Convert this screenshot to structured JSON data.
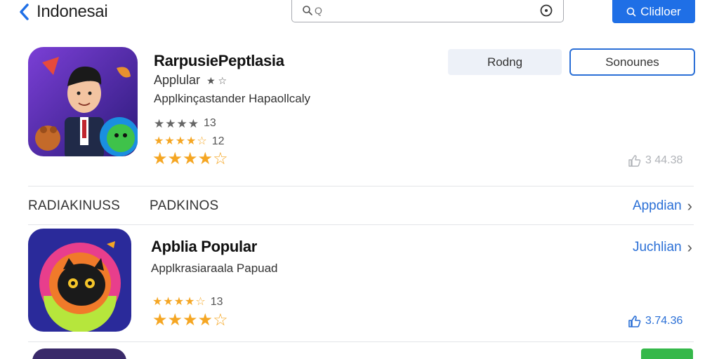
{
  "header": {
    "back_label": "Indonesai",
    "search_placeholder": "Q",
    "action_button": "Clidloer",
    "action_icon": "search-icon"
  },
  "featured": {
    "name": "RarpusiePeptlasia",
    "subtitle": "Applular",
    "subtitle_stars": "★ ☆",
    "description": "Applkinçastander Hapaollcaly",
    "rating_rows": [
      {
        "stars": "★★★★",
        "count": "13"
      },
      {
        "stars": "★★★★☆",
        "count": "12"
      },
      {
        "stars": "★★★★☆",
        "count": ""
      }
    ],
    "btn_secondary": "Rodng",
    "btn_primary": "Sonounes",
    "downloads": "3 44.38"
  },
  "section": {
    "label_left": "RADIAKINUSS",
    "label_mid": "PADKINOS",
    "link": "Appdian"
  },
  "app2": {
    "name": "Apblia Popular",
    "description": "Applkrasiaraala Papuad",
    "link": "Juchlian",
    "rating_rows": [
      {
        "stars": "★★★★☆",
        "count": "13"
      },
      {
        "stars": "★★★★☆",
        "count": ""
      }
    ],
    "downloads": "3.74.36"
  },
  "colors": {
    "accent": "#1f6fe6",
    "star": "#f5a623",
    "install": "#35b84a"
  }
}
